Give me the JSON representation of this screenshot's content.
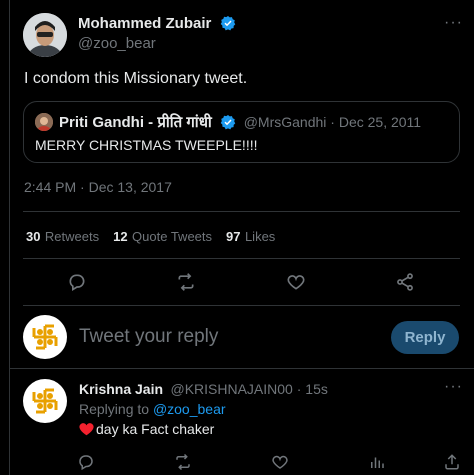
{
  "tweet": {
    "author_name": "Mohammed Zubair",
    "author_handle": "@zoo_bear",
    "text": "I  condom this Missionary tweet.",
    "timestamp": "2:44 PM · Dec 13, 2017",
    "more_label": "···"
  },
  "quote": {
    "author_name": "Priti Gandhi - प्रीति गांधी",
    "meta": "@MrsGandhi · Dec 25, 2011",
    "text": "MERRY CHRISTMAS TWEEPLE!!!!"
  },
  "stats": [
    {
      "num": "30",
      "label": "Retweets"
    },
    {
      "num": "12",
      "label": "Quote Tweets"
    },
    {
      "num": "97",
      "label": "Likes"
    }
  ],
  "composer": {
    "placeholder": "Tweet your reply",
    "reply_label": "Reply"
  },
  "reply": {
    "author_name": "Krishna Jain",
    "meta": "@KRISHNAJAIN00 · 15s",
    "replying_prefix": "Replying to ",
    "replying_handle": "@zoo_bear",
    "text": "day ka Fact chaker",
    "more_label": "···"
  },
  "colors": {
    "accent": "#1d9bf0",
    "like_red": "#f4212e",
    "muted": "#71767b",
    "border": "#2f3336"
  },
  "icons": [
    "comment-icon",
    "retweet-icon",
    "like-icon",
    "share-icon",
    "verified-badge-icon",
    "analytics-icon"
  ]
}
